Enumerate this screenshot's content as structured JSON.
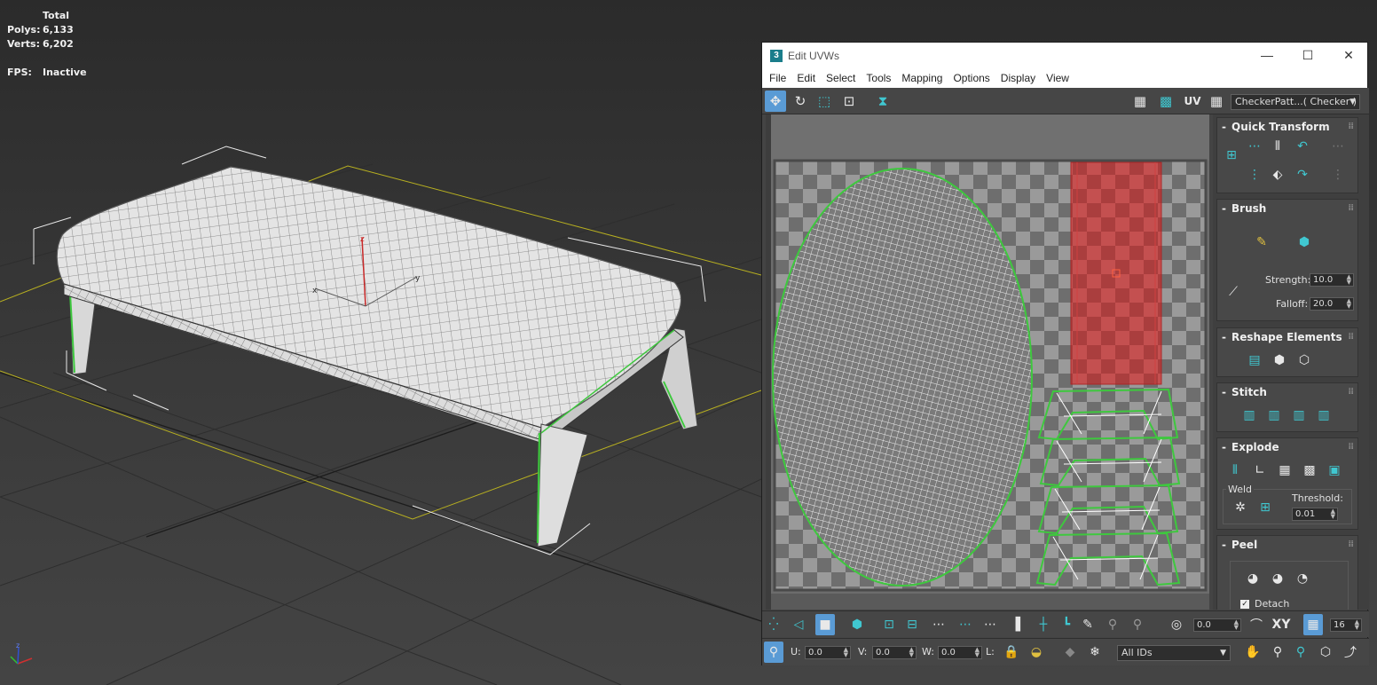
{
  "viewport": {
    "stats": {
      "header": "Total",
      "polys_label": "Polys:",
      "polys_value": "6,133",
      "verts_label": "Verts:",
      "verts_value": "6,202"
    },
    "fps_label": "FPS:",
    "fps_value": "Inactive",
    "axis_x": "x",
    "axis_y": "y",
    "axis_z": "z"
  },
  "window": {
    "title": "Edit UVWs",
    "app_icon": "3",
    "minimize": "—",
    "maximize": "☐",
    "close": "✕"
  },
  "menu": [
    "File",
    "Edit",
    "Select",
    "Tools",
    "Mapping",
    "Options",
    "Display",
    "View"
  ],
  "top_toolbar": {
    "uv_label": "UV",
    "texture_dropdown": "CheckerPatt...( Checker )"
  },
  "panel": {
    "quick_transform": {
      "title": "Quick Transform"
    },
    "brush": {
      "title": "Brush",
      "strength_label": "Strength:",
      "strength_value": "10.0",
      "falloff_label": "Falloff:",
      "falloff_value": "20.0"
    },
    "reshape": {
      "title": "Reshape Elements"
    },
    "stitch": {
      "title": "Stitch"
    },
    "explode": {
      "title": "Explode",
      "weld_label": "Weld",
      "threshold_label": "Threshold:",
      "threshold_value": "0.01"
    },
    "peel": {
      "title": "Peel",
      "detach_label": "Detach",
      "detach_checked": true
    }
  },
  "bottom_toolbar_1": {
    "angle_value": "0.0",
    "xy_label": "XY",
    "grid_value": "16"
  },
  "bottom_toolbar_2": {
    "u_label": "U:",
    "u_value": "0.0",
    "v_label": "V:",
    "v_value": "0.0",
    "w_label": "W:",
    "w_value": "0.0",
    "l_label": "L:",
    "ids_dropdown": "All IDs"
  },
  "colors": {
    "accent_teal": "#40c7d0",
    "active_blue": "#5a9bd5",
    "selection_red": "#c83232",
    "seam_green": "#3ec83e"
  }
}
